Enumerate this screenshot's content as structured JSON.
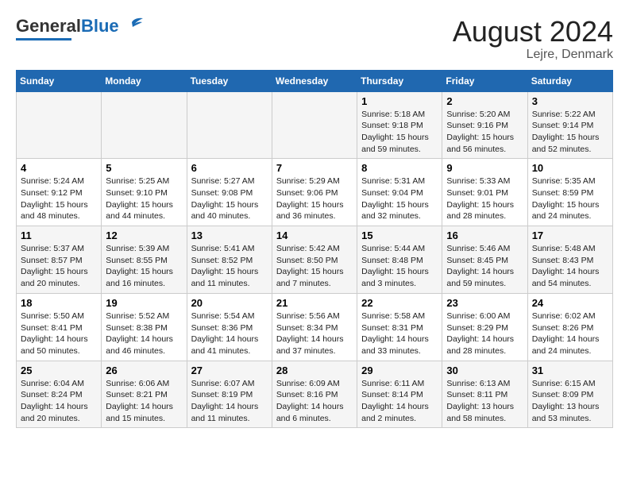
{
  "header": {
    "logo_general": "General",
    "logo_blue": "Blue",
    "title": "August 2024",
    "subtitle": "Lejre, Denmark"
  },
  "days_of_week": [
    "Sunday",
    "Monday",
    "Tuesday",
    "Wednesday",
    "Thursday",
    "Friday",
    "Saturday"
  ],
  "weeks": [
    [
      {
        "day": "",
        "info": ""
      },
      {
        "day": "",
        "info": ""
      },
      {
        "day": "",
        "info": ""
      },
      {
        "day": "",
        "info": ""
      },
      {
        "day": "1",
        "info": "Sunrise: 5:18 AM\nSunset: 9:18 PM\nDaylight: 15 hours\nand 59 minutes."
      },
      {
        "day": "2",
        "info": "Sunrise: 5:20 AM\nSunset: 9:16 PM\nDaylight: 15 hours\nand 56 minutes."
      },
      {
        "day": "3",
        "info": "Sunrise: 5:22 AM\nSunset: 9:14 PM\nDaylight: 15 hours\nand 52 minutes."
      }
    ],
    [
      {
        "day": "4",
        "info": "Sunrise: 5:24 AM\nSunset: 9:12 PM\nDaylight: 15 hours\nand 48 minutes."
      },
      {
        "day": "5",
        "info": "Sunrise: 5:25 AM\nSunset: 9:10 PM\nDaylight: 15 hours\nand 44 minutes."
      },
      {
        "day": "6",
        "info": "Sunrise: 5:27 AM\nSunset: 9:08 PM\nDaylight: 15 hours\nand 40 minutes."
      },
      {
        "day": "7",
        "info": "Sunrise: 5:29 AM\nSunset: 9:06 PM\nDaylight: 15 hours\nand 36 minutes."
      },
      {
        "day": "8",
        "info": "Sunrise: 5:31 AM\nSunset: 9:04 PM\nDaylight: 15 hours\nand 32 minutes."
      },
      {
        "day": "9",
        "info": "Sunrise: 5:33 AM\nSunset: 9:01 PM\nDaylight: 15 hours\nand 28 minutes."
      },
      {
        "day": "10",
        "info": "Sunrise: 5:35 AM\nSunset: 8:59 PM\nDaylight: 15 hours\nand 24 minutes."
      }
    ],
    [
      {
        "day": "11",
        "info": "Sunrise: 5:37 AM\nSunset: 8:57 PM\nDaylight: 15 hours\nand 20 minutes."
      },
      {
        "day": "12",
        "info": "Sunrise: 5:39 AM\nSunset: 8:55 PM\nDaylight: 15 hours\nand 16 minutes."
      },
      {
        "day": "13",
        "info": "Sunrise: 5:41 AM\nSunset: 8:52 PM\nDaylight: 15 hours\nand 11 minutes."
      },
      {
        "day": "14",
        "info": "Sunrise: 5:42 AM\nSunset: 8:50 PM\nDaylight: 15 hours\nand 7 minutes."
      },
      {
        "day": "15",
        "info": "Sunrise: 5:44 AM\nSunset: 8:48 PM\nDaylight: 15 hours\nand 3 minutes."
      },
      {
        "day": "16",
        "info": "Sunrise: 5:46 AM\nSunset: 8:45 PM\nDaylight: 14 hours\nand 59 minutes."
      },
      {
        "day": "17",
        "info": "Sunrise: 5:48 AM\nSunset: 8:43 PM\nDaylight: 14 hours\nand 54 minutes."
      }
    ],
    [
      {
        "day": "18",
        "info": "Sunrise: 5:50 AM\nSunset: 8:41 PM\nDaylight: 14 hours\nand 50 minutes."
      },
      {
        "day": "19",
        "info": "Sunrise: 5:52 AM\nSunset: 8:38 PM\nDaylight: 14 hours\nand 46 minutes."
      },
      {
        "day": "20",
        "info": "Sunrise: 5:54 AM\nSunset: 8:36 PM\nDaylight: 14 hours\nand 41 minutes."
      },
      {
        "day": "21",
        "info": "Sunrise: 5:56 AM\nSunset: 8:34 PM\nDaylight: 14 hours\nand 37 minutes."
      },
      {
        "day": "22",
        "info": "Sunrise: 5:58 AM\nSunset: 8:31 PM\nDaylight: 14 hours\nand 33 minutes."
      },
      {
        "day": "23",
        "info": "Sunrise: 6:00 AM\nSunset: 8:29 PM\nDaylight: 14 hours\nand 28 minutes."
      },
      {
        "day": "24",
        "info": "Sunrise: 6:02 AM\nSunset: 8:26 PM\nDaylight: 14 hours\nand 24 minutes."
      }
    ],
    [
      {
        "day": "25",
        "info": "Sunrise: 6:04 AM\nSunset: 8:24 PM\nDaylight: 14 hours\nand 20 minutes."
      },
      {
        "day": "26",
        "info": "Sunrise: 6:06 AM\nSunset: 8:21 PM\nDaylight: 14 hours\nand 15 minutes."
      },
      {
        "day": "27",
        "info": "Sunrise: 6:07 AM\nSunset: 8:19 PM\nDaylight: 14 hours\nand 11 minutes."
      },
      {
        "day": "28",
        "info": "Sunrise: 6:09 AM\nSunset: 8:16 PM\nDaylight: 14 hours\nand 6 minutes."
      },
      {
        "day": "29",
        "info": "Sunrise: 6:11 AM\nSunset: 8:14 PM\nDaylight: 14 hours\nand 2 minutes."
      },
      {
        "day": "30",
        "info": "Sunrise: 6:13 AM\nSunset: 8:11 PM\nDaylight: 13 hours\nand 58 minutes."
      },
      {
        "day": "31",
        "info": "Sunrise: 6:15 AM\nSunset: 8:09 PM\nDaylight: 13 hours\nand 53 minutes."
      }
    ]
  ]
}
